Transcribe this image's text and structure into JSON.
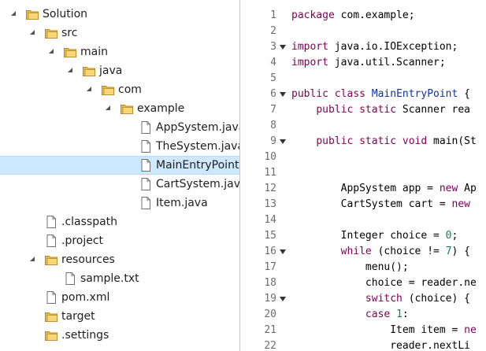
{
  "colors": {
    "selection": "#cde8ff",
    "keyword": "#7f0055",
    "type": "#0d33a5",
    "number": "#098658",
    "folder": "#e9b949",
    "line_number": "#6d6d6d"
  },
  "tree": [
    {
      "label": "Solution",
      "level": 0,
      "kind": "folder",
      "expander": "open",
      "selected": false
    },
    {
      "label": "src",
      "level": 1,
      "kind": "folder",
      "expander": "open",
      "selected": false
    },
    {
      "label": "main",
      "level": 2,
      "kind": "folder",
      "expander": "open",
      "selected": false
    },
    {
      "label": "java",
      "level": 3,
      "kind": "folder",
      "expander": "open",
      "selected": false
    },
    {
      "label": "com",
      "level": 4,
      "kind": "folder",
      "expander": "open",
      "selected": false
    },
    {
      "label": "example",
      "level": 5,
      "kind": "folder",
      "expander": "open",
      "selected": false
    },
    {
      "label": "AppSystem.java",
      "level": 6,
      "kind": "file",
      "expander": "none",
      "selected": false
    },
    {
      "label": "TheSystem.java",
      "level": 6,
      "kind": "file",
      "expander": "none",
      "selected": false
    },
    {
      "label": "MainEntryPoint.java",
      "level": 6,
      "kind": "file",
      "expander": "none",
      "selected": true
    },
    {
      "label": "CartSystem.java",
      "level": 6,
      "kind": "file",
      "expander": "none",
      "selected": false
    },
    {
      "label": "Item.java",
      "level": 6,
      "kind": "file",
      "expander": "none",
      "selected": false
    },
    {
      "label": ".classpath",
      "level": 1,
      "kind": "file",
      "expander": "none",
      "selected": false
    },
    {
      "label": ".project",
      "level": 1,
      "kind": "file",
      "expander": "none",
      "selected": false
    },
    {
      "label": "resources",
      "level": 1,
      "kind": "folder",
      "expander": "open",
      "selected": false
    },
    {
      "label": "sample.txt",
      "level": 2,
      "kind": "file",
      "expander": "none",
      "selected": false
    },
    {
      "label": "pom.xml",
      "level": 1,
      "kind": "file",
      "expander": "none",
      "selected": false
    },
    {
      "label": "target",
      "level": 1,
      "kind": "folder",
      "expander": "closed",
      "selected": false
    },
    {
      "label": ".settings",
      "level": 1,
      "kind": "folder",
      "expander": "closed",
      "selected": false
    }
  ],
  "code_lines": [
    {
      "num": "1",
      "fold": false,
      "tokens": [
        [
          "kw",
          "package"
        ],
        [
          "plain",
          " com.example;"
        ]
      ]
    },
    {
      "num": "2",
      "fold": false,
      "tokens": []
    },
    {
      "num": "3",
      "fold": true,
      "tokens": [
        [
          "kw",
          "import"
        ],
        [
          "plain",
          " java.io.IOException;"
        ]
      ]
    },
    {
      "num": "4",
      "fold": false,
      "tokens": [
        [
          "kw",
          "import"
        ],
        [
          "plain",
          " java.util.Scanner;"
        ]
      ]
    },
    {
      "num": "5",
      "fold": false,
      "tokens": []
    },
    {
      "num": "6",
      "fold": true,
      "tokens": [
        [
          "kw",
          "public"
        ],
        [
          "plain",
          " "
        ],
        [
          "kw",
          "class"
        ],
        [
          "plain",
          " "
        ],
        [
          "type",
          "MainEntryPoint"
        ],
        [
          "plain",
          " {"
        ]
      ]
    },
    {
      "num": "7",
      "fold": false,
      "tokens": [
        [
          "plain",
          "    "
        ],
        [
          "kw",
          "public"
        ],
        [
          "plain",
          " "
        ],
        [
          "kw",
          "static"
        ],
        [
          "plain",
          " Scanner rea"
        ]
      ]
    },
    {
      "num": "8",
      "fold": false,
      "tokens": []
    },
    {
      "num": "9",
      "fold": true,
      "tokens": [
        [
          "plain",
          "    "
        ],
        [
          "kw",
          "public"
        ],
        [
          "plain",
          " "
        ],
        [
          "kw",
          "static"
        ],
        [
          "plain",
          " "
        ],
        [
          "kw",
          "void"
        ],
        [
          "plain",
          " main(St"
        ]
      ]
    },
    {
      "num": "10",
      "fold": false,
      "tokens": []
    },
    {
      "num": "11",
      "fold": false,
      "tokens": []
    },
    {
      "num": "12",
      "fold": false,
      "tokens": [
        [
          "plain",
          "        AppSystem app = "
        ],
        [
          "kw",
          "new"
        ],
        [
          "plain",
          " Ap"
        ]
      ]
    },
    {
      "num": "13",
      "fold": false,
      "tokens": [
        [
          "plain",
          "        CartSystem cart = "
        ],
        [
          "kw",
          "new"
        ]
      ]
    },
    {
      "num": "14",
      "fold": false,
      "tokens": []
    },
    {
      "num": "15",
      "fold": false,
      "tokens": [
        [
          "plain",
          "        Integer choice = "
        ],
        [
          "num",
          "0"
        ],
        [
          "plain",
          ";"
        ]
      ]
    },
    {
      "num": "16",
      "fold": true,
      "tokens": [
        [
          "plain",
          "        "
        ],
        [
          "kw",
          "while"
        ],
        [
          "plain",
          " (choice != "
        ],
        [
          "num",
          "7"
        ],
        [
          "plain",
          ") {"
        ]
      ]
    },
    {
      "num": "17",
      "fold": false,
      "tokens": [
        [
          "plain",
          "            menu();"
        ]
      ]
    },
    {
      "num": "18",
      "fold": false,
      "tokens": [
        [
          "plain",
          "            choice = reader.ne"
        ]
      ]
    },
    {
      "num": "19",
      "fold": true,
      "tokens": [
        [
          "plain",
          "            "
        ],
        [
          "kw",
          "switch"
        ],
        [
          "plain",
          " (choice) {"
        ]
      ]
    },
    {
      "num": "20",
      "fold": false,
      "tokens": [
        [
          "plain",
          "            "
        ],
        [
          "kw",
          "case"
        ],
        [
          "plain",
          " "
        ],
        [
          "num",
          "1"
        ],
        [
          "plain",
          ":"
        ]
      ]
    },
    {
      "num": "21",
      "fold": false,
      "tokens": [
        [
          "plain",
          "                Item item = "
        ],
        [
          "kw",
          "ne"
        ]
      ]
    },
    {
      "num": "22",
      "fold": false,
      "tokens": [
        [
          "plain",
          "                reader.nextLi"
        ]
      ]
    }
  ]
}
